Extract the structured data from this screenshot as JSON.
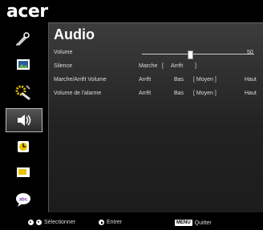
{
  "logo": "acer",
  "sidebar": [
    {
      "icon": "picture-settings-icon"
    },
    {
      "icon": "image-icon"
    },
    {
      "icon": "management-tools-icon"
    },
    {
      "icon": "audio-speaker-icon",
      "active": true
    },
    {
      "icon": "timer-icon"
    },
    {
      "icon": "screen-icon"
    },
    {
      "icon": "language-icon"
    }
  ],
  "panel": {
    "title": "Audio",
    "volume": {
      "label": "Volume",
      "value": "50",
      "level": 0.43
    },
    "silence": {
      "label": "Silence",
      "opt1": "Marche",
      "bracket_open": "[",
      "opt2": "Arrêt",
      "bracket_close": "]"
    },
    "power_volume": {
      "label": "Marche/Arrêt Volume",
      "opt1": "Arrêt",
      "opt2": "Bas",
      "opt3": "[ Moyen ]",
      "opt4": "Haut"
    },
    "alarm_volume": {
      "label": "Volume de l'alarme",
      "opt1": "Arrêt",
      "opt2": "Bas",
      "opt3": "[ Moyen ]",
      "opt4": "Haut"
    }
  },
  "footer": {
    "select_label": "Sélectionner",
    "enter_label": "Entrer",
    "menu_key": "MENU",
    "quit_label": "Quitter"
  },
  "colors": {
    "background": "#000000",
    "panel_top": "#3c3c3c",
    "panel_bottom": "#1c1c1c",
    "text": "#dddddd"
  }
}
